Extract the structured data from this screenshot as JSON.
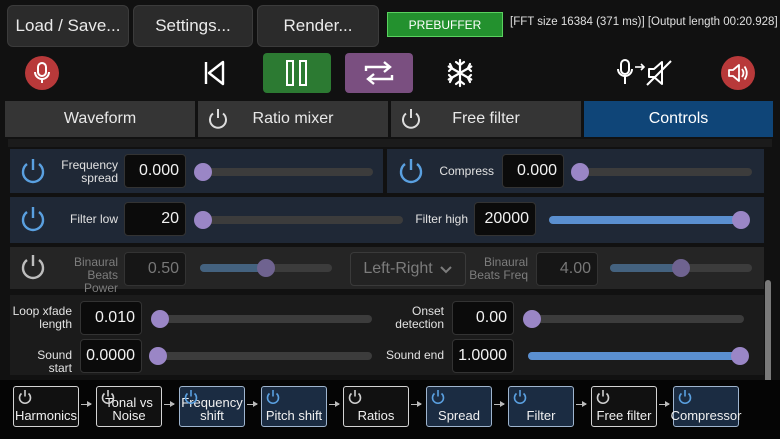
{
  "menu": {
    "load_save": "Load / Save...",
    "settings": "Settings...",
    "render": "Render..."
  },
  "status": {
    "prebuffer": "PREBUFFER",
    "info": "[FFT size 16384 (371 ms)] [Output length 00:20.928]"
  },
  "transport": {
    "icons": [
      "mic-icon",
      "skip-back-icon",
      "pause-icon",
      "loop-icon",
      "freeze-snowflake-icon",
      "mic-to-speaker-off-icon",
      "speaker-icon"
    ]
  },
  "tabs": [
    {
      "label": "Waveform",
      "active": false
    },
    {
      "label": "Ratio mixer",
      "active": false
    },
    {
      "label": "Free filter",
      "active": false
    },
    {
      "label": "Controls",
      "active": true
    }
  ],
  "controls": {
    "frequency_spread": {
      "label": "Frequency spread",
      "value": "0.000",
      "level": 0.0
    },
    "compress": {
      "label": "Compress",
      "value": "0.000",
      "level": 0.0
    },
    "filter_low": {
      "label": "Filter low",
      "value": "20",
      "level": 0.0
    },
    "filter_high": {
      "label": "Filter high",
      "value": "20000",
      "level": 1.0
    },
    "binaural_power": {
      "label": "Binaural Beats Power",
      "value": "0.50",
      "level": 0.5
    },
    "binaural_mode": {
      "value": "Left-Right"
    },
    "binaural_freq": {
      "label": "Binaural Beats Freq",
      "value": "4.00",
      "level": 0.5
    },
    "loop_xfade": {
      "label": "Loop xfade length",
      "value": "0.010",
      "level": 0.0
    },
    "onset_detection": {
      "label": "Onset detection",
      "value": "0.00",
      "level": 0.0
    },
    "sound_start": {
      "label": "Sound start",
      "value": "0.0000",
      "level": 0.0
    },
    "sound_end": {
      "label": "Sound end",
      "value": "1.0000",
      "level": 1.0
    }
  },
  "chain": [
    {
      "label": "Harmonics",
      "active": false
    },
    {
      "label": "Tonal vs Noise",
      "active": false
    },
    {
      "label": "Frequency shift",
      "active": true
    },
    {
      "label": "Pitch shift",
      "active": true
    },
    {
      "label": "Ratios",
      "active": false
    },
    {
      "label": "Spread",
      "active": true
    },
    {
      "label": "Filter",
      "active": true
    },
    {
      "label": "Free filter",
      "active": false
    },
    {
      "label": "Compressor",
      "active": true
    }
  ],
  "colors": {
    "accent_blue": "#5a8fd0",
    "tab_active": "#0f4578",
    "thumb": "#9a86c6",
    "prebuffer_green": "#23912e",
    "record_red": "#b8393a"
  }
}
